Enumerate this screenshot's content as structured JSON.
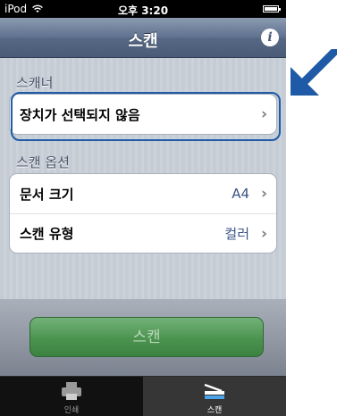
{
  "status_bar": {
    "carrier": "iPod",
    "time": "오후 3:20"
  },
  "nav": {
    "title": "스캔",
    "info_glyph": "i"
  },
  "scanner_section": {
    "header": "스캐너",
    "device_label": "장치가 선택되지 않음"
  },
  "options_section": {
    "header": "스캔 옵션",
    "rows": [
      {
        "label": "문서 크기",
        "value": "A4"
      },
      {
        "label": "스캔 유형",
        "value": "컬러"
      }
    ]
  },
  "scan_button_label": "스캔",
  "tabs": [
    {
      "label": "인쇄",
      "icon": "printer-icon",
      "active": false
    },
    {
      "label": "스캔",
      "icon": "scanner-icon",
      "active": true
    }
  ],
  "accent_colors": {
    "nav": "#5f7190",
    "scan_button": "#4b934f",
    "pointer_arrow": "#1e5aa6"
  }
}
